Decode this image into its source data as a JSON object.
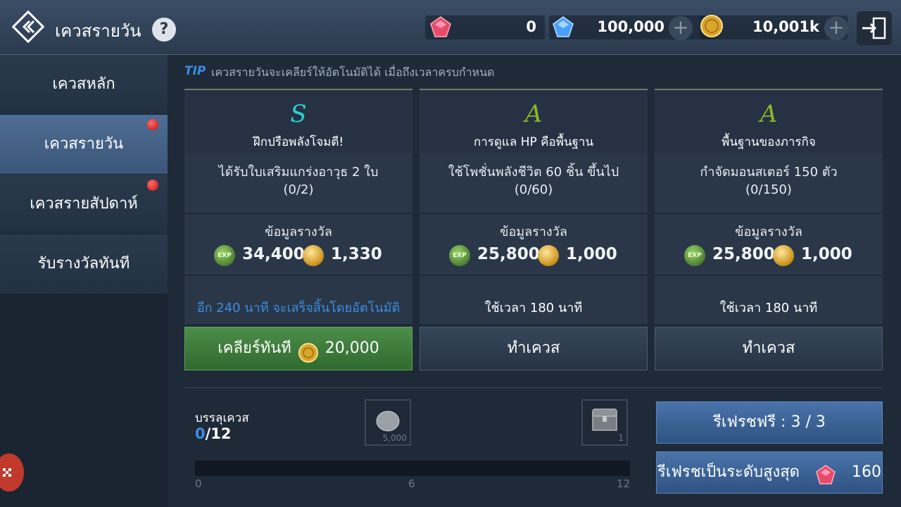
{
  "header": {
    "title": "เควสรายวัน",
    "help_symbol": "?",
    "currencies": [
      {
        "name": "red-gem",
        "icon": "red-gem-icon",
        "value": "0",
        "color": "#e84a6a"
      },
      {
        "name": "blue-gem",
        "icon": "blue-diamond-icon",
        "value": "100,000",
        "color": "#4aa0ff"
      },
      {
        "name": "gold",
        "icon": "gold-coin-icon",
        "value": "10,001k",
        "color": "#e0b030"
      }
    ],
    "plus_symbol": "+"
  },
  "sidebar": {
    "items": [
      {
        "label": "เควสหลัก",
        "active": false,
        "badge": false
      },
      {
        "label": "เควสรายวัน",
        "active": true,
        "badge": true
      },
      {
        "label": "เควสรายสัปดาห์",
        "active": false,
        "badge": true
      },
      {
        "label": "รับรางวัลทันที",
        "active": false,
        "badge": false
      }
    ]
  },
  "tip": {
    "label": "TIP",
    "text": "เควสรายวันจะเคลียร์ให้อัตโนมัติได้ เมื่อถึงเวลาครบกำหนด"
  },
  "quests": [
    {
      "grade": "S",
      "grade_color": "#2ad0d0",
      "title": "ฝึกปรือพลังโจมตี!",
      "desc1": "ได้รับใบเสริมแกร่งอาวุธ 2 ใบ",
      "desc2": "(0/2)",
      "reward_title": "ข้อมูลรางวัล",
      "exp": "34,400",
      "gold": "1,330",
      "footer": "อีก 240 นาที จะเสร็จสิ้นโดยอัตโนมัติ",
      "footer_color": "#3a8de0",
      "button": "เคลียร์ทันที",
      "button_cost": "20,000"
    },
    {
      "grade": "A",
      "grade_color": "#8ab828",
      "title": "การดูแล HP คือพื้นฐาน",
      "desc1": "ใช้โพชั่นพลังชีวิต 60 ชิ้น ขึ้นไป",
      "desc2": "(0/60)",
      "reward_title": "ข้อมูลรางวัล",
      "exp": "25,800",
      "gold": "1,000",
      "footer": "ใช้เวลา 180 นาที",
      "footer_color": "#e8edf2",
      "button": "ทำเควส"
    },
    {
      "grade": "A",
      "grade_color": "#8ab828",
      "title": "พื้นฐานของภารกิจ",
      "desc1": "กำจัดมอนสเตอร์ 150 ตัว",
      "desc2": "(0/150)",
      "reward_title": "ข้อมูลรางวัล",
      "exp": "25,800",
      "gold": "1,000",
      "footer": "ใช้เวลา 180 นาที",
      "footer_color": "#e8edf2",
      "button": "ทำเควส"
    }
  ],
  "exp_badge": "EXP",
  "bundle": {
    "label": "บรรลุเควส",
    "current": "0",
    "total": "/12",
    "progress": 0,
    "ticks": [
      "0",
      "6",
      "12"
    ],
    "rewards": [
      {
        "icon": "silver-stone-icon",
        "caption": "5,000"
      },
      {
        "icon": "treasure-chest-icon",
        "caption": "1"
      }
    ]
  },
  "refresh": {
    "free_label": "รีเฟรชฟรี : 3 / 3",
    "max_label": "รีเฟรชเป็นระดับสูงสุด",
    "max_cost": "160"
  }
}
